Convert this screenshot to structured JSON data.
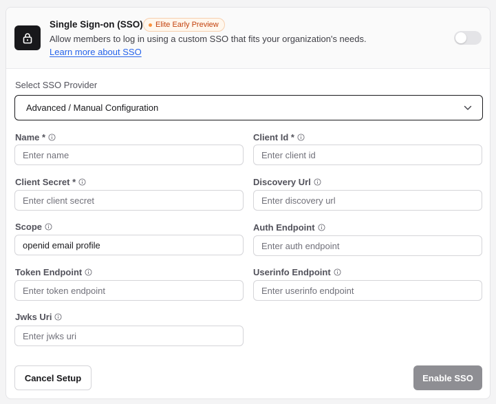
{
  "header": {
    "title": "Single Sign-on (SSO)",
    "badge": "Elite Early Preview",
    "description": "Allow members to log in using a custom SSO that fits your organization's needs.",
    "learn_more": "Learn more about SSO",
    "toggle_on": false
  },
  "provider": {
    "label": "Select SSO Provider",
    "selected": "Advanced / Manual Configuration"
  },
  "fields": {
    "name": {
      "label": "Name *",
      "placeholder": "Enter name",
      "value": ""
    },
    "client_id": {
      "label": "Client Id *",
      "placeholder": "Enter client id",
      "value": ""
    },
    "client_secret": {
      "label": "Client Secret *",
      "placeholder": "Enter client secret",
      "value": ""
    },
    "discovery_url": {
      "label": "Discovery Url",
      "placeholder": "Enter discovery url",
      "value": ""
    },
    "scope": {
      "label": "Scope",
      "placeholder": "",
      "value": "openid email profile"
    },
    "auth_endpoint": {
      "label": "Auth Endpoint",
      "placeholder": "Enter auth endpoint",
      "value": ""
    },
    "token_endpoint": {
      "label": "Token Endpoint",
      "placeholder": "Enter token endpoint",
      "value": ""
    },
    "userinfo_endpoint": {
      "label": "Userinfo Endpoint",
      "placeholder": "Enter userinfo endpoint",
      "value": ""
    },
    "jwks_uri": {
      "label": "Jwks Uri",
      "placeholder": "Enter jwks uri",
      "value": ""
    }
  },
  "actions": {
    "cancel": "Cancel Setup",
    "enable": "Enable SSO"
  },
  "icons": {
    "header": "lock-icon",
    "field_hint": "info-icon",
    "dropdown": "chevron-down-icon"
  },
  "colors": {
    "lock_tile": "#18181b",
    "link": "#2563eb",
    "badge_text": "#c2410c",
    "enable_button": "#8e8e93"
  }
}
